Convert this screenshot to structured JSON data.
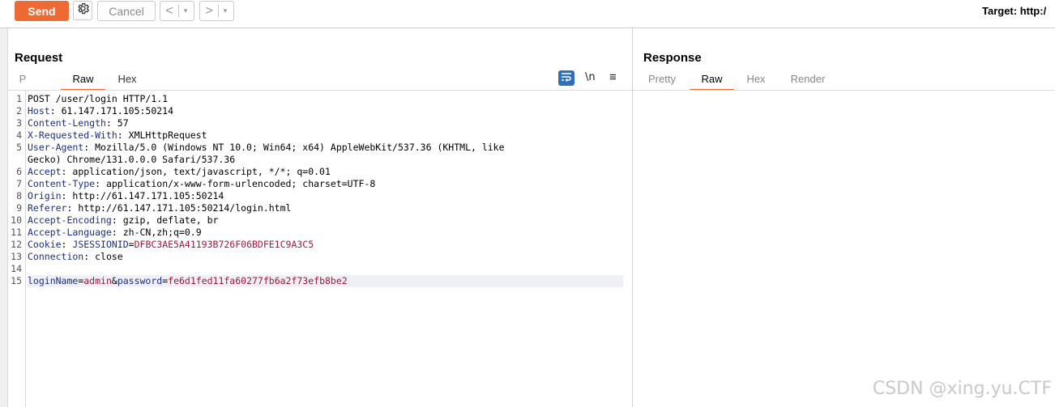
{
  "toolbar": {
    "send_label": "Send",
    "cancel_label": "Cancel",
    "back_glyph": "<",
    "forward_glyph": ">",
    "dropdown_glyph": "▾",
    "target_label": "Target: http:/"
  },
  "request": {
    "title": "Request",
    "tabs": [
      {
        "label": "P",
        "active": false
      },
      {
        "label": "Raw",
        "active": true
      },
      {
        "label": "Hex",
        "active": false
      }
    ],
    "newline_label": "\\n",
    "menu_glyph": "≡",
    "lines": [
      {
        "num": "1",
        "name": "",
        "value": "POST /user/login HTTP/1.1"
      },
      {
        "num": "2",
        "name": "Host",
        "value": "61.147.171.105:50214"
      },
      {
        "num": "3",
        "name": "Content-Length",
        "value": "57"
      },
      {
        "num": "4",
        "name": "X-Requested-With",
        "value": "XMLHttpRequest"
      },
      {
        "num": "5",
        "name": "User-Agent",
        "value": "Mozilla/5.0 (Windows NT 10.0; Win64; x64) AppleWebKit/537.36 (KHTML, like"
      },
      {
        "num": "",
        "name": "",
        "value": "Gecko) Chrome/131.0.0.0 Safari/537.36"
      },
      {
        "num": "6",
        "name": "Accept",
        "value": "application/json, text/javascript, */*; q=0.01"
      },
      {
        "num": "7",
        "name": "Content-Type",
        "value": "application/x-www-form-urlencoded; charset=UTF-8"
      },
      {
        "num": "8",
        "name": "Origin",
        "value": "http://61.147.171.105:50214"
      },
      {
        "num": "9",
        "name": "Referer",
        "value": "http://61.147.171.105:50214/login.html"
      },
      {
        "num": "10",
        "name": "Accept-Encoding",
        "value": "gzip, deflate, br"
      },
      {
        "num": "11",
        "name": "Accept-Language",
        "value": "zh-CN,zh;q=0.9"
      },
      {
        "num": "12",
        "name": "Cookie",
        "value": "",
        "cookie_name": "JSESSIONID",
        "cookie_value": "DFBC3AE5A41193B726F06BDFE1C9A3C5"
      },
      {
        "num": "13",
        "name": "Connection",
        "value": "close"
      },
      {
        "num": "14",
        "name": "",
        "value": ""
      },
      {
        "num": "15",
        "name": "",
        "value": "",
        "body": true,
        "p1_name": "loginName",
        "p1_value": "admin",
        "p2_name": "password",
        "p2_value": "fe6d1fed11fa60277fb6a2f73efb8be2"
      }
    ]
  },
  "response": {
    "title": "Response",
    "tabs": [
      {
        "label": "Pretty",
        "active": false
      },
      {
        "label": "Raw",
        "active": true
      },
      {
        "label": "Hex",
        "active": false
      },
      {
        "label": "Render",
        "active": false
      }
    ]
  },
  "watermark": "CSDN @xing.yu.CTF",
  "colors": {
    "accent": "#ee6a35",
    "header_name": "#1b2f88",
    "param_value": "#a0183a"
  }
}
